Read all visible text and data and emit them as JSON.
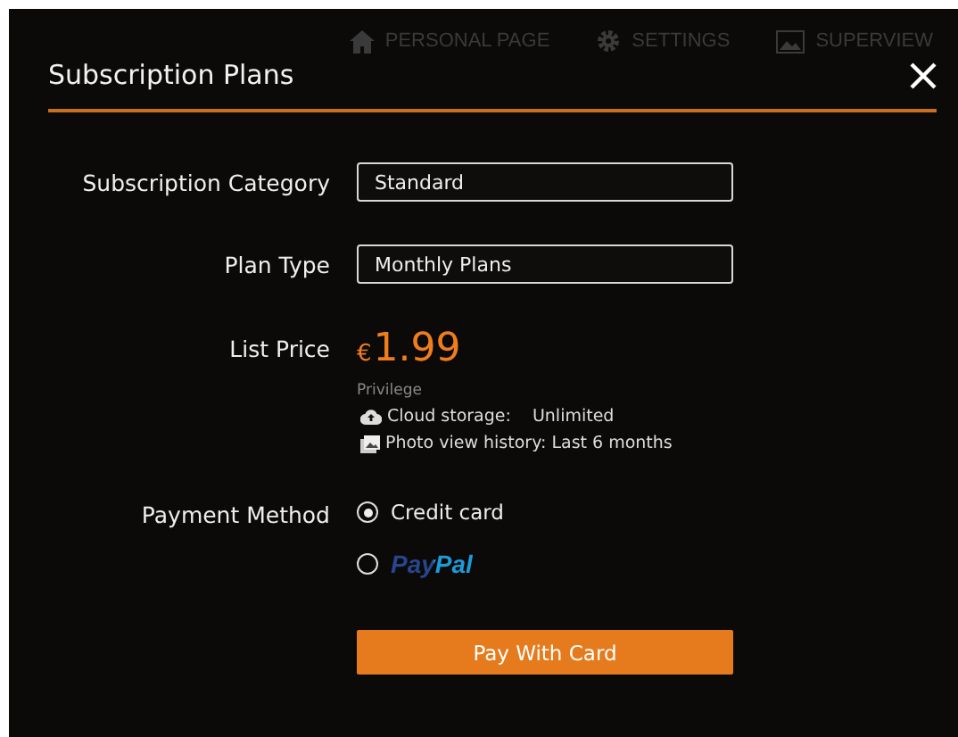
{
  "background_nav": [
    {
      "kind": "home",
      "label": "PERSONAL PAGE"
    },
    {
      "kind": "gear",
      "label": "SETTINGS"
    },
    {
      "kind": "image",
      "label": "SUPERVIEW"
    }
  ],
  "dialog": {
    "title": "Subscription Plans",
    "fields": [
      {
        "label": "Subscription Category",
        "value": "Standard"
      },
      {
        "label": "Plan Type",
        "value": "Monthly Plans"
      }
    ],
    "list_price": {
      "label": "List Price",
      "currency": "€",
      "amount": "1.99"
    },
    "privilege": {
      "heading": "Privilege",
      "items": [
        {
          "kind": "cloud",
          "text": "Cloud storage:",
          "value": "Unlimited"
        },
        {
          "kind": "photo",
          "text": "Photo view history: Last 6 months"
        }
      ]
    },
    "payment": {
      "label": "Payment Method",
      "options": [
        {
          "kind": "text",
          "label": "Credit card",
          "selected": true
        },
        {
          "kind": "paypal",
          "label": "PayPal",
          "selected": false
        }
      ]
    },
    "button": "Pay With Card"
  }
}
